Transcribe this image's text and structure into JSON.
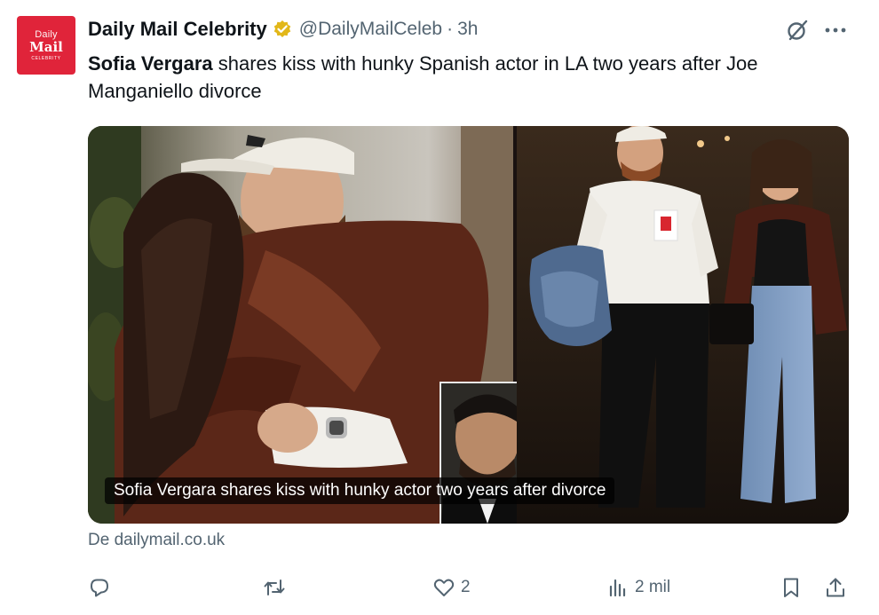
{
  "account": {
    "avatar_line1": "Daily",
    "avatar_line2": "Mail",
    "avatar_line3": "CELEBRITY",
    "display_name": "Daily Mail Celebrity",
    "handle": "@DailyMailCeleb",
    "separator": "·",
    "time": "3h"
  },
  "tweet": {
    "bold_part": "Sofia Vergara",
    "rest_part": " shares kiss with hunky Spanish actor in LA two years after Joe Manganiello divorce"
  },
  "card": {
    "caption": "Sofia Vergara shares kiss with hunky actor two years after divorce",
    "source": "De dailymail.co.uk"
  },
  "actions": {
    "reply_count": "",
    "retweet_count": "",
    "like_count": "2",
    "views_count": "2 mil"
  },
  "icons": {
    "verified": "verified-badge-icon",
    "grok": "grok-icon",
    "more": "more-icon",
    "reply": "reply-icon",
    "retweet": "retweet-icon",
    "like": "heart-icon",
    "views": "views-icon",
    "bookmark": "bookmark-icon",
    "share": "share-icon"
  },
  "colors": {
    "text": "#0f1419",
    "secondary": "#536471",
    "brand": "#e0243a",
    "verified": "#e2b719"
  }
}
